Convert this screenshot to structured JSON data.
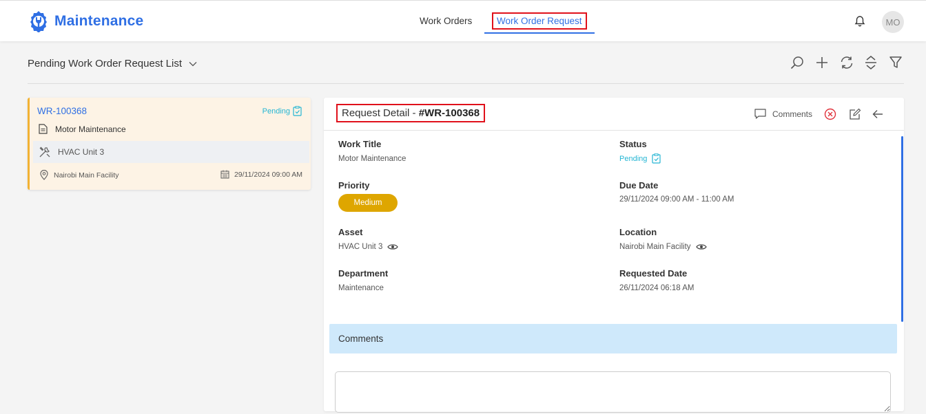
{
  "app": {
    "name": "Maintenance",
    "brand_color": "#2f6fe4"
  },
  "nav": {
    "work_orders": "Work Orders",
    "work_order_request": "Work Order Request",
    "avatar_initials": "MO"
  },
  "list": {
    "title": "Pending Work Order Request List",
    "toolbar": [
      "search-icon",
      "add-icon",
      "refresh-icon",
      "expand-collapse-icon",
      "filter-icon"
    ]
  },
  "card": {
    "id": "WR-100368",
    "status": "Pending",
    "title": "Motor Maintenance",
    "asset": "HVAC Unit 3",
    "location": "Nairobi Main Facility",
    "date": "29/11/2024 09:00 AM"
  },
  "detail": {
    "title_prefix": "Request Detail - ",
    "title_id": "#WR-100368",
    "comments_label": "Comments",
    "fields": {
      "work_title_label": "Work Title",
      "work_title": "Motor Maintenance",
      "status_label": "Status",
      "status": "Pending",
      "priority_label": "Priority",
      "priority": "Medium",
      "due_date_label": "Due Date",
      "due_date": "29/11/2024 09:00 AM - 11:00 AM",
      "asset_label": "Asset",
      "asset": "HVAC Unit 3",
      "location_label": "Location",
      "location": "Nairobi Main Facility",
      "department_label": "Department",
      "department": "Maintenance",
      "requested_date_label": "Requested Date",
      "requested_date": "26/11/2024 06:18 AM"
    },
    "comments_section": "Comments",
    "comment_input": ""
  },
  "colors": {
    "pending": "#23b5d3",
    "priority_medium": "#dea600",
    "card_bg": "#fdf3e5",
    "card_accent": "#f2b233",
    "comments_bar": "#cfe9fb",
    "highlight_box": "#e0101a"
  }
}
